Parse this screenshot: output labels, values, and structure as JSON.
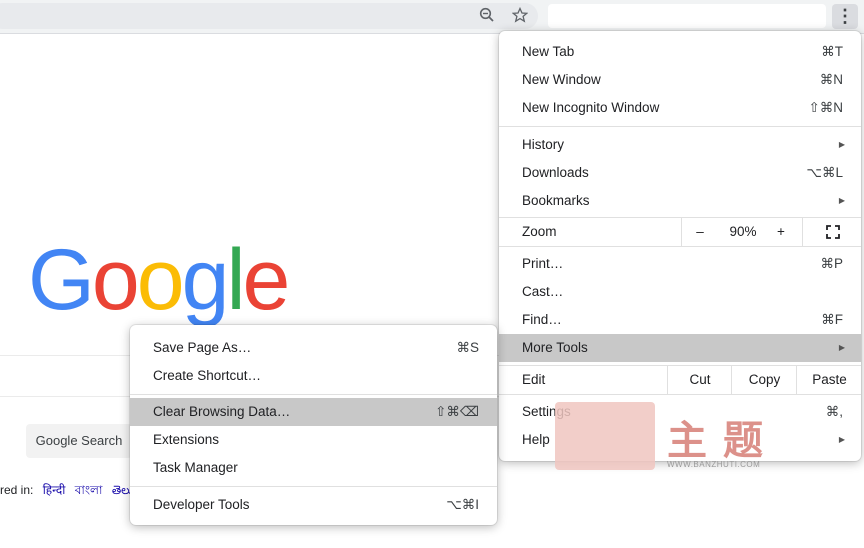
{
  "toolbar": {
    "zoom_icon": "zoom-out-icon",
    "star_icon": "star-icon",
    "menu_icon": "more-vert-icon"
  },
  "google": {
    "logo_letters": [
      {
        "ch": "G",
        "color": "#4285F4"
      },
      {
        "ch": "o",
        "color": "#EA4335"
      },
      {
        "ch": "o",
        "color": "#FBBC05"
      },
      {
        "ch": "g",
        "color": "#4285F4"
      },
      {
        "ch": "l",
        "color": "#34A853"
      },
      {
        "ch": "e",
        "color": "#EA4335"
      }
    ],
    "search_button": "Google Search",
    "offered_label": "red in:",
    "languages": [
      "हिन्दी",
      "বাংলা",
      "తెలుగు"
    ]
  },
  "menu": {
    "new_tab": {
      "label": "New Tab",
      "shortcut": "⌘T"
    },
    "new_window": {
      "label": "New Window",
      "shortcut": "⌘N"
    },
    "new_incognito": {
      "label": "New Incognito Window",
      "shortcut": "⇧⌘N"
    },
    "history": {
      "label": "History"
    },
    "downloads": {
      "label": "Downloads",
      "shortcut": "⌥⌘L"
    },
    "bookmarks": {
      "label": "Bookmarks"
    },
    "zoom": {
      "label": "Zoom",
      "minus": "–",
      "level": "90%",
      "plus": "+",
      "fullscreen_icon": "fullscreen-icon"
    },
    "print": {
      "label": "Print…",
      "shortcut": "⌘P"
    },
    "cast": {
      "label": "Cast…"
    },
    "find": {
      "label": "Find…",
      "shortcut": "⌘F"
    },
    "more_tools": {
      "label": "More Tools"
    },
    "edit": {
      "label": "Edit",
      "cut": "Cut",
      "copy": "Copy",
      "paste": "Paste"
    },
    "settings": {
      "label": "Settings",
      "shortcut": "⌘,"
    },
    "help": {
      "label": "Help"
    }
  },
  "submenu": {
    "save_page": {
      "label": "Save Page As…",
      "shortcut": "⌘S"
    },
    "create_shortcut": {
      "label": "Create Shortcut…"
    },
    "clear_data": {
      "label": "Clear Browsing Data…",
      "shortcut": "⇧⌘⌫"
    },
    "extensions": {
      "label": "Extensions"
    },
    "task_manager": {
      "label": "Task Manager"
    },
    "dev_tools": {
      "label": "Developer Tools",
      "shortcut": "⌥⌘I"
    }
  },
  "watermark": {
    "chars": [
      "主",
      "题"
    ],
    "url": "WWW.BANZHUTI.COM"
  }
}
